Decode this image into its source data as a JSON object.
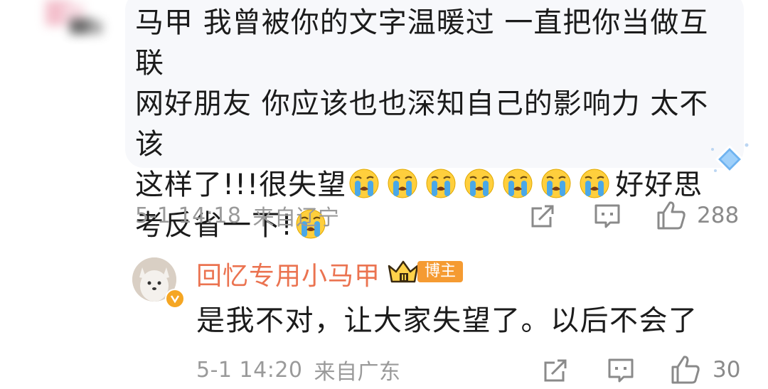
{
  "comment": {
    "line1": "马甲 我曾被你的文字温暖过 一直把你当做互联",
    "line2": "网好朋友 你应该也也深知自己的影响力 太不该",
    "line3_text": "这样了!!!很失望",
    "line3_tail": "好好思",
    "line4_text": "考反省一下!",
    "emoji_icon": "crying-face-emoji",
    "time": "5-1 14:18",
    "location": "来自辽宁",
    "like_count": "288"
  },
  "reply": {
    "username": "回忆专用小马甲",
    "badge": "博主",
    "text": "是我不对，让大家失望了。以后不会了",
    "time": "5-1 14:20",
    "location": "来自广东",
    "like_count": "30"
  },
  "icons": {
    "share": "share-icon",
    "comment": "comment-icon",
    "like": "thumbs-up-icon",
    "crown": "crown-icon",
    "verify": "verified-icon"
  },
  "colors": {
    "username": "#eb7350",
    "badge": "#f59b32",
    "meta": "#9a9a9a",
    "bubble": "#f7f8fb"
  }
}
